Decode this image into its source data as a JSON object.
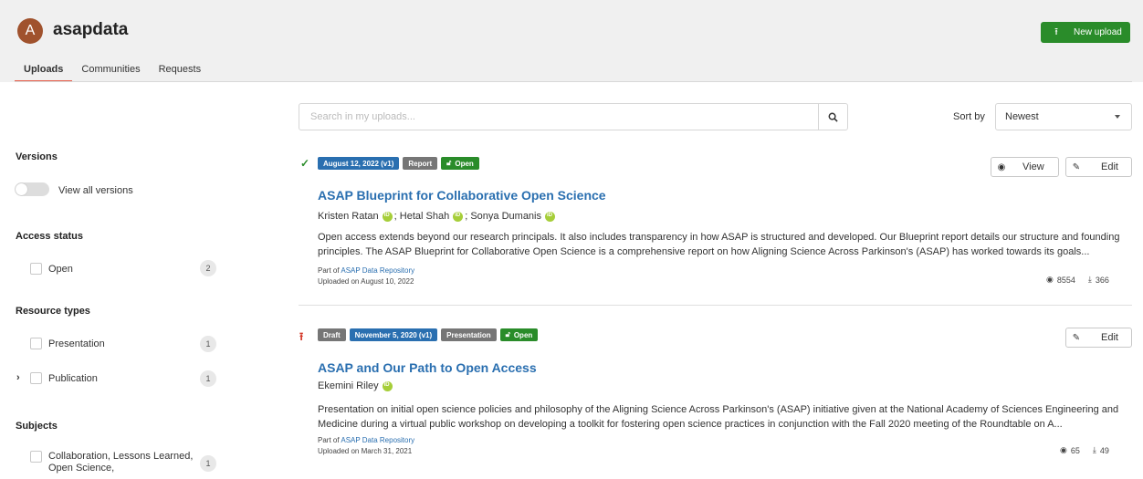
{
  "header": {
    "avatar_letter": "A",
    "username": "asapdata",
    "new_upload_label": "New upload",
    "tabs": [
      "Uploads",
      "Communities",
      "Requests"
    ]
  },
  "search": {
    "placeholder": "Search in my uploads...",
    "value": ""
  },
  "sort": {
    "label": "Sort by",
    "value": "Newest"
  },
  "sidebar": {
    "versions": {
      "heading": "Versions",
      "toggle_label": "View all versions"
    },
    "access_status": {
      "heading": "Access status",
      "items": [
        {
          "label": "Open",
          "count": "2"
        }
      ]
    },
    "resource_types": {
      "heading": "Resource types",
      "items": [
        {
          "label": "Presentation",
          "count": "1"
        },
        {
          "label": "Publication",
          "count": "1"
        }
      ]
    },
    "subjects": {
      "heading": "Subjects",
      "items": [
        {
          "label_line1": "Collaboration, Lessons Learned,",
          "label_line2": "Open Science,",
          "count": "1"
        }
      ]
    }
  },
  "results": [
    {
      "badges": {
        "date": "August 12, 2022 (v1)",
        "type": "Report",
        "access": "Open"
      },
      "title": "ASAP Blueprint for Collaborative Open Science",
      "creators": [
        "Kristen Ratan",
        "Hetal Shah",
        "Sonya Dumanis"
      ],
      "description_line1": "Open access extends beyond our research principals. It also includes transparency in how ASAP is structured and developed. Our Blueprint report details our structure and founding",
      "description_line2": "principles. The ASAP Blueprint for Collaborative Open Science is a comprehensive report on how Aligning Science Across Parkinson's (ASAP) has worked towards its goals...",
      "part_of_prefix": "Part of ",
      "part_of": "ASAP Data Repository",
      "uploaded": "Uploaded on August 10, 2022",
      "views": "8554",
      "downloads": "366",
      "view_label": "View",
      "edit_label": "Edit"
    },
    {
      "badges": {
        "draft": "Draft",
        "date": "November 5, 2020 (v1)",
        "type": "Presentation",
        "access": "Open"
      },
      "title": "ASAP and Our Path to Open Access",
      "creators": [
        "Ekemini Riley"
      ],
      "description_line1": "Presentation on initial open science policies and philosophy of the Aligning Science Across Parkinson's (ASAP) initiative given at the National Academy of Sciences Engineering and",
      "description_line2": "Medicine during a virtual public workshop on developing a toolkit for fostering open science practices in conjunction with the Fall 2020 meeting of the Roundtable on A...",
      "part_of_prefix": "Part of ",
      "part_of": "ASAP Data Repository",
      "uploaded": "Uploaded on March 31, 2021",
      "views": "65",
      "downloads": "49",
      "edit_label": "Edit"
    }
  ]
}
